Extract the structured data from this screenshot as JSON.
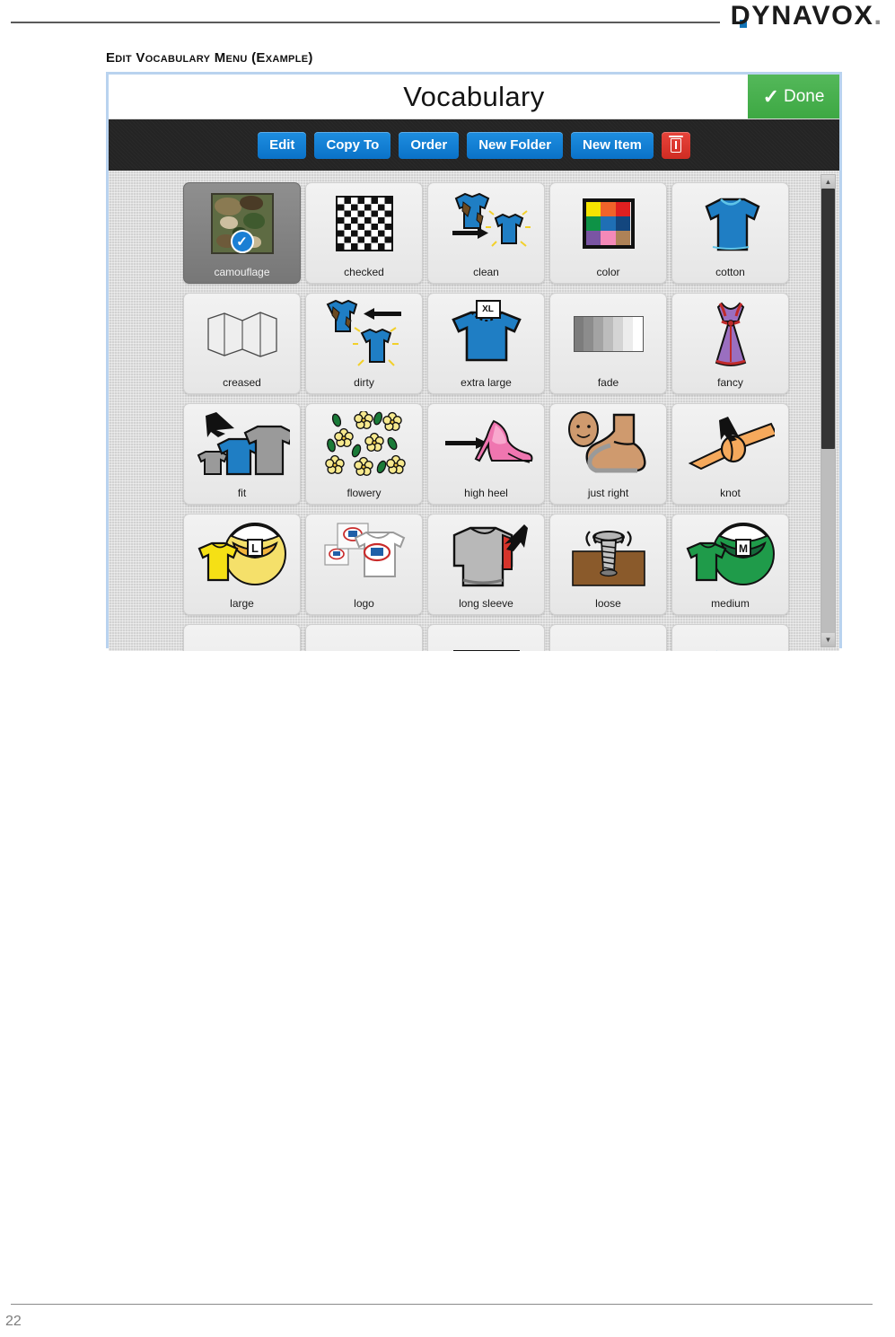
{
  "document": {
    "brand": "DYNAVOX",
    "brand_dot": ".",
    "section_title": "Edit Vocabulary Menu (Example)",
    "page_number": "22"
  },
  "app": {
    "title": "Vocabulary",
    "done_button": {
      "label": "Done",
      "check_glyph": "✓",
      "color": "#48ad4e"
    },
    "toolbar": {
      "buttons": [
        {
          "label": "Edit",
          "name": "edit-button"
        },
        {
          "label": "Copy To",
          "name": "copy-to-button"
        },
        {
          "label": "Order",
          "name": "order-button"
        },
        {
          "label": "New Folder",
          "name": "new-folder-button"
        },
        {
          "label": "New Item",
          "name": "new-item-button"
        }
      ],
      "delete_button": {
        "icon": "trash-icon",
        "color": "#d93a30"
      },
      "button_color": "#0f7bd0",
      "bar_color": "#242424"
    },
    "scrollbar": {
      "up_glyph": "▲",
      "down_glyph": "▼",
      "thumb_position_percent": 0,
      "thumb_size_percent": 58
    },
    "grid": {
      "columns": 5,
      "selected_cell": "camouflage",
      "selection_badge_glyph": "✓",
      "cells": [
        {
          "label": "camouflage",
          "icon": "camouflage-swatch-icon",
          "selected": true
        },
        {
          "label": "checked",
          "icon": "checkerboard-icon",
          "selected": false
        },
        {
          "label": "clean",
          "icon": "dirty-to-clean-shirt-icon",
          "selected": false
        },
        {
          "label": "color",
          "icon": "color-palette-grid-icon",
          "selected": false
        },
        {
          "label": "cotton",
          "icon": "blue-tshirt-icon",
          "selected": false
        },
        {
          "label": "creased",
          "icon": "folded-paper-icon",
          "selected": false
        },
        {
          "label": "dirty",
          "icon": "clean-to-dirty-shirt-icon",
          "selected": false
        },
        {
          "label": "extra large",
          "icon": "xl-shirt-icon",
          "selected": false
        },
        {
          "label": "fade",
          "icon": "gray-gradient-icon",
          "selected": false
        },
        {
          "label": "fancy",
          "icon": "purple-dress-icon",
          "selected": false
        },
        {
          "label": "fit",
          "icon": "three-shirts-fit-icon",
          "selected": false
        },
        {
          "label": "flowery",
          "icon": "yellow-flowers-icon",
          "selected": false
        },
        {
          "label": "high heel",
          "icon": "pink-high-heel-icon",
          "selected": false
        },
        {
          "label": "just right",
          "icon": "foot-in-shoe-icon",
          "selected": false
        },
        {
          "label": "knot",
          "icon": "rope-knot-icon",
          "selected": false
        },
        {
          "label": "large",
          "icon": "yellow-shirt-large-icon",
          "selected": false
        },
        {
          "label": "logo",
          "icon": "white-shirt-logo-icon",
          "selected": false
        },
        {
          "label": "long sleeve",
          "icon": "long-sleeve-shirt-icon",
          "selected": false
        },
        {
          "label": "loose",
          "icon": "loose-screw-icon",
          "selected": false
        },
        {
          "label": "medium",
          "icon": "green-shirt-medium-icon",
          "selected": false
        }
      ],
      "partial_row_cells": [
        {
          "label": "",
          "icon": "beaded-pattern-icon"
        },
        {
          "label": "",
          "icon": "striped-pattern-icon"
        },
        {
          "label": "",
          "icon": "polka-dot-pattern-icon"
        },
        {
          "label": "",
          "icon": "beaded-pattern-icon"
        },
        {
          "label": "",
          "icon": "shiny-sparkle-icon"
        }
      ]
    },
    "colors": {
      "palette_swatches": [
        "#f5e400",
        "#f0632a",
        "#e02020",
        "#0e9246",
        "#1f6fb5",
        "#13467e",
        "#7a55a3",
        "#f489b8",
        "#ae8257"
      ],
      "fade_steps": [
        "#7c7c7c",
        "#8c8c8c",
        "#a3a3a3",
        "#bcbcbc",
        "#d4d4d4",
        "#ececec",
        "#ffffff"
      ],
      "selected_cell_bg": "#828282",
      "grid_bg": "#d2d2d2"
    }
  }
}
